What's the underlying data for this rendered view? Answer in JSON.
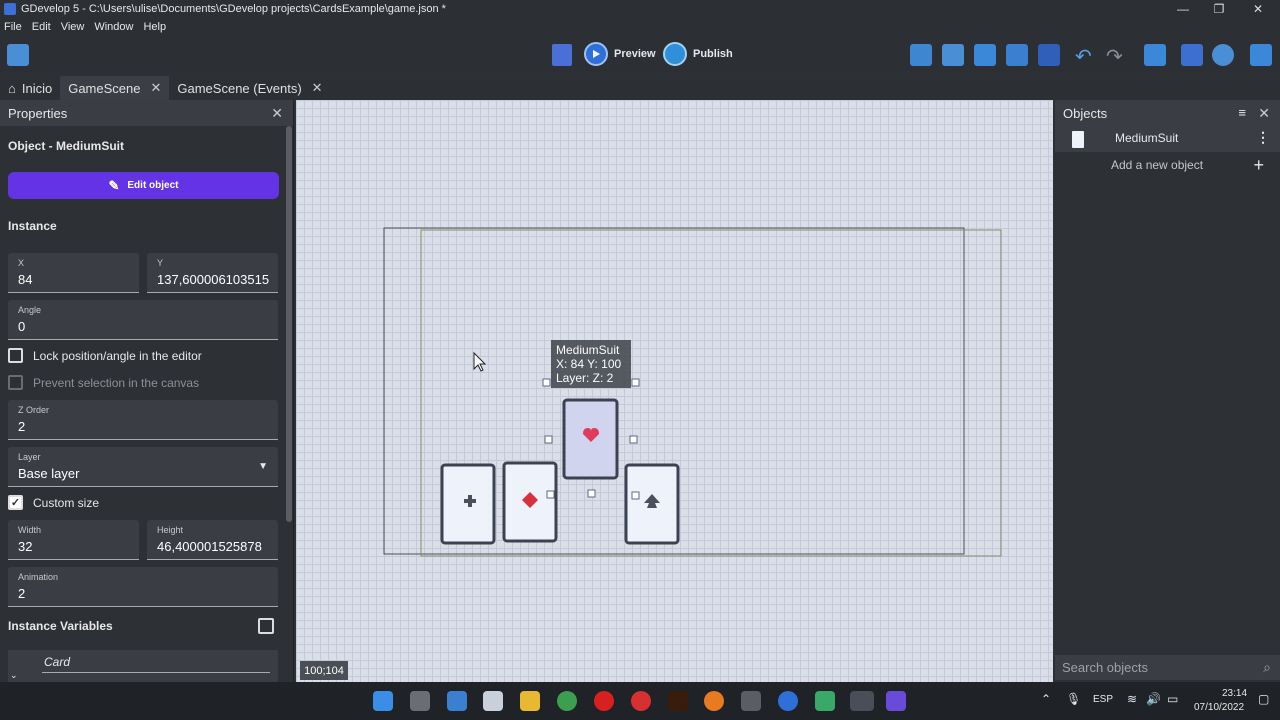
{
  "window": {
    "title": "GDevelop 5 - C:\\Users\\ulise\\Documents\\GDevelop projects\\CardsExample\\game.json *",
    "minimize": "—",
    "maximize": "❐",
    "close": "✕"
  },
  "menu": [
    "File",
    "Edit",
    "View",
    "Window",
    "Help"
  ],
  "toolbar": {
    "preview": "Preview",
    "publish": "Publish"
  },
  "tabs": [
    {
      "label": "Inicio"
    },
    {
      "label": "GameScene"
    },
    {
      "label": "GameScene (Events)"
    }
  ],
  "properties": {
    "title": "Properties",
    "object_title": "Object  - MediumSuit",
    "edit_button": "Edit object",
    "instance_heading": "Instance",
    "x_label": "X",
    "x_value": "84",
    "y_label": "Y",
    "y_value": "137,600006103515",
    "angle_label": "Angle",
    "angle_value": "0",
    "lock_label": "Lock position/angle in the editor",
    "prevent_label": "Prevent selection in the canvas",
    "zorder_label": "Z Order",
    "zorder_value": "2",
    "layer_label": "Layer",
    "layer_value": "Base layer",
    "custom_size_label": "Custom size",
    "width_label": "Width",
    "width_value": "32",
    "height_label": "Height",
    "height_value": "46,400001525878",
    "animation_label": "Animation",
    "animation_value": "2",
    "variables_heading": "Instance Variables",
    "variable_name": "Card"
  },
  "canvas": {
    "tooltip_name": "MediumSuit",
    "tooltip_pos": "X: 84  Y: 100",
    "tooltip_layer": "Layer:   Z: 2",
    "coord_readout": "100;104"
  },
  "objects": {
    "title": "Objects",
    "items": [
      {
        "name": "MediumSuit"
      }
    ],
    "add_label": "Add a new object",
    "search_placeholder": "Search objects"
  },
  "taskbar": {
    "lang": "ESP",
    "time": "23:14",
    "date": "07/10/2022"
  }
}
